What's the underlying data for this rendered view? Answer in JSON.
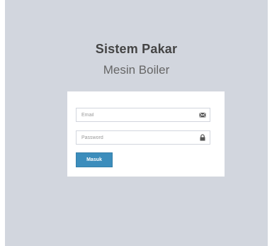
{
  "logo": {
    "title": "Sistem Pakar",
    "subtitle": "Mesin Boiler"
  },
  "login_form": {
    "email": {
      "placeholder": "Email",
      "value": "",
      "icon": "envelope-icon"
    },
    "password": {
      "placeholder": "Password",
      "value": "",
      "icon": "lock-icon"
    },
    "submit_label": "Masuk"
  },
  "colors": {
    "background": "#d2d6de",
    "box": "#ffffff",
    "button": "#3c8dbc",
    "title_text": "#444444"
  }
}
